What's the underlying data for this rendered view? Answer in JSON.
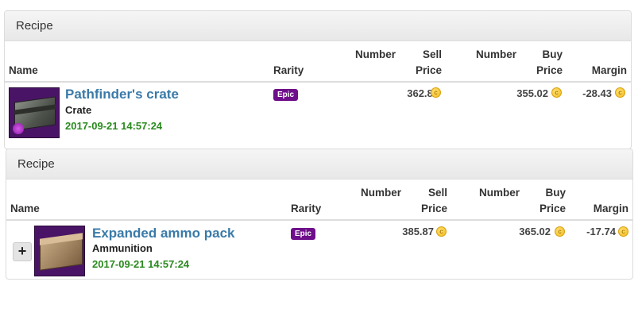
{
  "tables": [
    {
      "heading": "Recipe",
      "columns": {
        "name": "Name",
        "rarity": "Rarity",
        "sell_number": "Number",
        "sell_price_1": "Sell",
        "sell_price_2": "Price",
        "buy_number": "Number",
        "buy_price_1": "Buy",
        "buy_price_2": "Price",
        "margin": "Margin"
      },
      "row": {
        "name": "Pathfinder's crate",
        "category": "Crate",
        "date": "2017-09-21 14:57:24",
        "rarity": "Epic",
        "sell_price": "362.88",
        "buy_price": "355.02",
        "margin": "-28.43",
        "icon": "crate-icon"
      }
    },
    {
      "heading": "Recipe",
      "columns": {
        "name": "Name",
        "rarity": "Rarity",
        "sell_number": "Number",
        "sell_price_1": "Sell",
        "sell_price_2": "Price",
        "buy_number": "Number",
        "buy_price_1": "Buy",
        "buy_price_2": "Price",
        "margin": "Margin"
      },
      "row": {
        "expand_label": "+",
        "name": "Expanded ammo pack",
        "category": "Ammunition",
        "date": "2017-09-21 14:57:24",
        "rarity": "Epic",
        "sell_price": "385.87",
        "buy_price": "365.02",
        "margin": "-17.74",
        "icon": "ammo-box-icon"
      }
    }
  ],
  "colors": {
    "rarity_epic": "#6e0e8a",
    "item_link": "#3a7aa8",
    "date": "#2a8a1e",
    "coin": "#f0b814"
  },
  "coin_symbol": "c"
}
